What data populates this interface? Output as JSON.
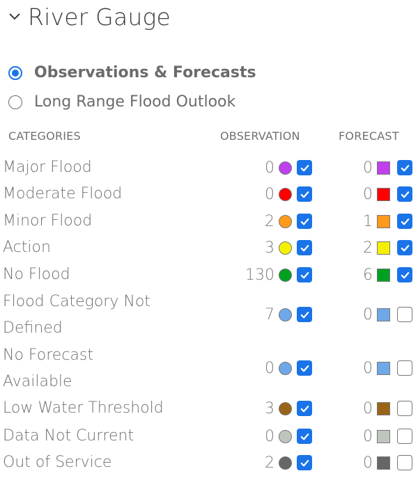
{
  "header": {
    "title": "River Gauge",
    "toggle_icon": "chevron-down-icon",
    "expanded": true
  },
  "mode_options": [
    {
      "label": "Observations & Forecasts",
      "selected": true
    },
    {
      "label": "Long Range Flood Outlook",
      "selected": false
    }
  ],
  "table": {
    "columns": {
      "categories": "CATEGORIES",
      "observation": "OBSERVATION",
      "forecast": "FORECAST"
    },
    "rows": [
      {
        "category": "Major Flood",
        "color": "#c140ee",
        "obs_count": "0",
        "obs_checked": true,
        "fc_count": "0",
        "fc_checked": true
      },
      {
        "category": "Moderate Flood",
        "color": "#ff0000",
        "obs_count": "0",
        "obs_checked": true,
        "fc_count": "0",
        "fc_checked": true
      },
      {
        "category": "Minor Flood",
        "color": "#ff9a1a",
        "obs_count": "2",
        "obs_checked": true,
        "fc_count": "1",
        "fc_checked": true
      },
      {
        "category": "Action",
        "color": "#f5f000",
        "obs_count": "3",
        "obs_checked": true,
        "fc_count": "2",
        "fc_checked": true
      },
      {
        "category": "No Flood",
        "color": "#00a020",
        "obs_count": "130",
        "obs_checked": true,
        "fc_count": "6",
        "fc_checked": true
      },
      {
        "category": "Flood Category Not Defined",
        "category_lines": [
          "Flood Category Not",
          "Defined"
        ],
        "color": "#6fa8e8",
        "obs_count": "7",
        "obs_checked": true,
        "fc_count": "0",
        "fc_checked": false
      },
      {
        "category": "No Forecast Available",
        "category_lines": [
          "No Forecast",
          "Available"
        ],
        "color": "#6fa8e8",
        "obs_count": "0",
        "obs_checked": true,
        "fc_count": "0",
        "fc_checked": false
      },
      {
        "category": "Low Water Threshold",
        "color": "#9a6418",
        "obs_count": "3",
        "obs_checked": true,
        "fc_count": "0",
        "fc_checked": false
      },
      {
        "category": "Data Not Current",
        "color": "#bfc4bd",
        "obs_count": "0",
        "obs_checked": true,
        "fc_count": "0",
        "fc_checked": false
      },
      {
        "category": "Out of Service",
        "color": "#666666",
        "obs_count": "2",
        "obs_checked": true,
        "fc_count": "0",
        "fc_checked": false
      }
    ]
  }
}
